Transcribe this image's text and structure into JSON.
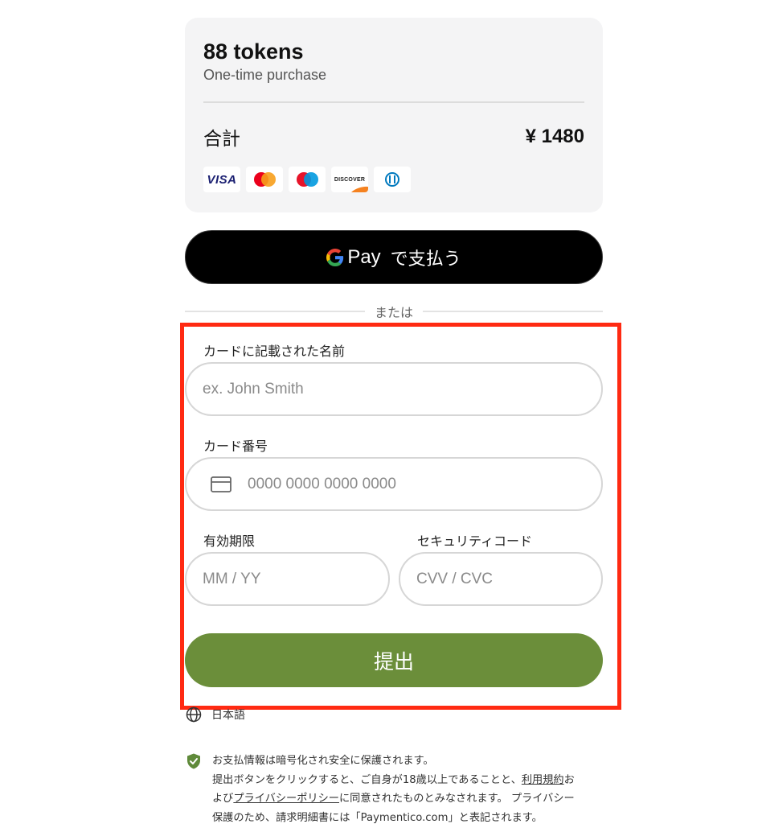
{
  "summary": {
    "product_name": "88 tokens",
    "product_subtitle": "One-time purchase",
    "total_label": "合計",
    "total_amount": "¥ 1480",
    "card_brands": [
      "VISA",
      "Mastercard",
      "Maestro",
      "DISCOVER",
      "Diners Club"
    ],
    "visa_text": "VISA",
    "discover_text": "DISCOVER"
  },
  "gpay": {
    "pay_text": "Pay",
    "label": "で支払う"
  },
  "divider": {
    "text": "または"
  },
  "form": {
    "name_label": "カードに記載された名前",
    "name_placeholder": "ex. John Smith",
    "card_label": "カード番号",
    "card_placeholder": "0000 0000 0000 0000",
    "expiry_label": "有効期限",
    "expiry_placeholder": "MM / YY",
    "cvc_label": "セキュリティコード",
    "cvc_placeholder": "CVV / CVC",
    "submit_label": "提出"
  },
  "language": {
    "label": "日本語"
  },
  "security": {
    "line1": "お支払情報は暗号化され安全に保護されます。",
    "line2_pre": "提出ボタンをクリックすると、ご自身が18歳以上であることと、",
    "terms_link": "利用規約",
    "line2_post": "お",
    "line3_pre": "よび",
    "privacy_link": "プライバシーポリシー",
    "line3_post": "に同意されたものとみなされます。 プライバシー",
    "line4": "保護のため、請求明細書には「Paymentico.com」と表記されます。"
  },
  "colors": {
    "highlight": "#ff2a12",
    "submit_bg": "#6b8e3a",
    "shield": "#5f8a3a"
  }
}
